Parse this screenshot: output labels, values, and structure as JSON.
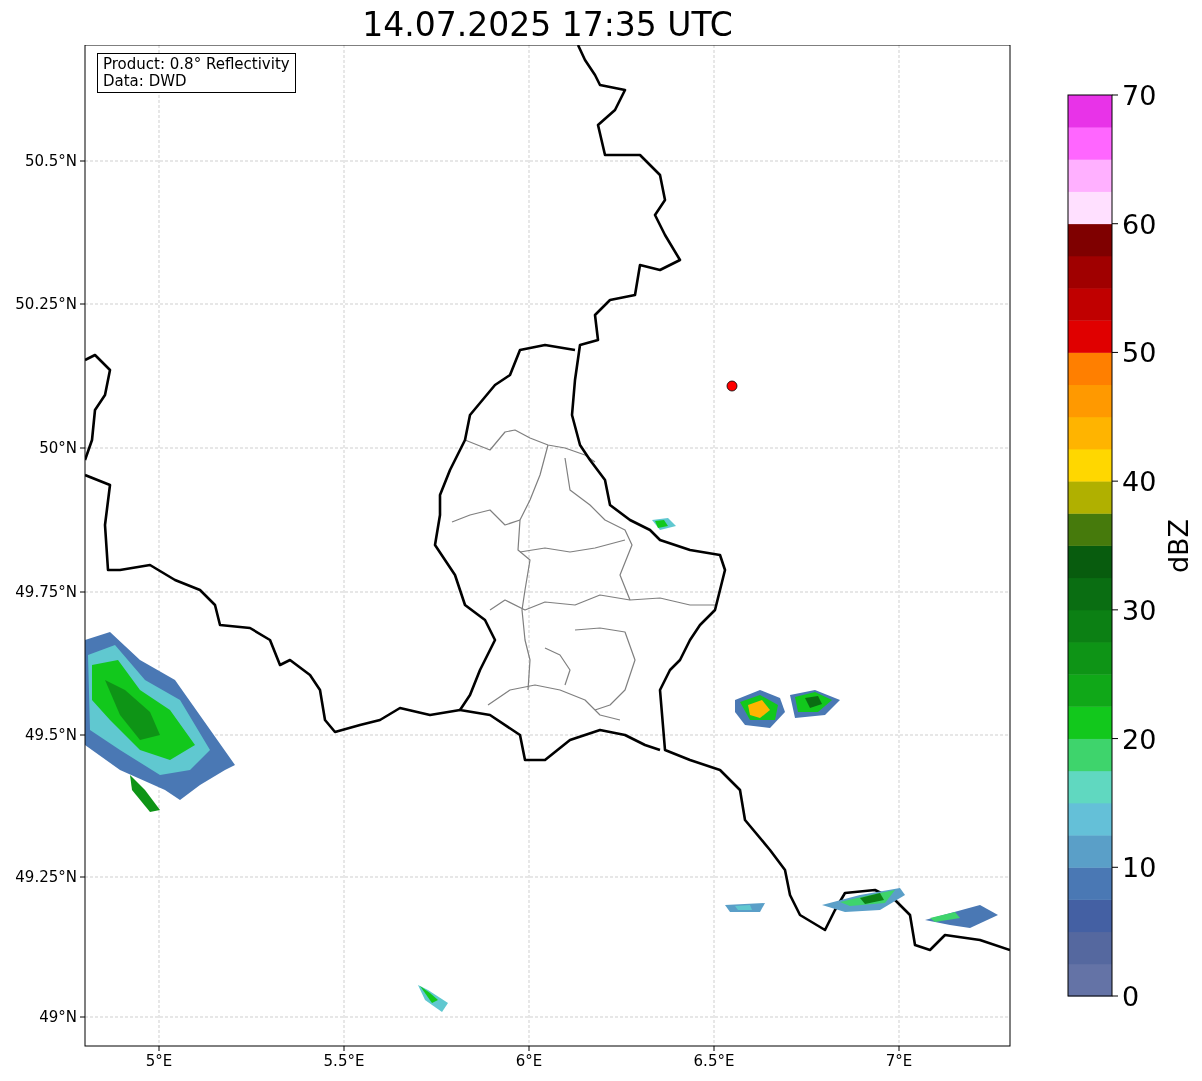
{
  "title": "14.07.2025 17:35 UTC",
  "info_box": {
    "lines": [
      "Product: 0.8° Reflectivity",
      "Data: DWD"
    ]
  },
  "map": {
    "y_ticks": [
      "50.5°N",
      "50.25°N",
      "50°N",
      "49.75°N",
      "49.5°N",
      "49.25°N",
      "49°N"
    ],
    "x_ticks": [
      "5°E",
      "5.5°E",
      "6°E",
      "6.5°E",
      "7°E"
    ]
  },
  "colorbar": {
    "label": "dBZ",
    "ticks": [
      "70",
      "60",
      "50",
      "40",
      "30",
      "20",
      "10",
      "0"
    ],
    "segments": [
      {
        "color": "#6473a6"
      },
      {
        "color": "#55689f"
      },
      {
        "color": "#4460a3"
      },
      {
        "color": "#4a78b4"
      },
      {
        "color": "#5a9fc8"
      },
      {
        "color": "#64c0d8"
      },
      {
        "color": "#60d8c0"
      },
      {
        "color": "#3ed46c"
      },
      {
        "color": "#12c81c"
      },
      {
        "color": "#10a818"
      },
      {
        "color": "#0e9416"
      },
      {
        "color": "#0c8014"
      },
      {
        "color": "#0a6e12"
      },
      {
        "color": "#085c0e"
      },
      {
        "color": "#467a0c"
      },
      {
        "color": "#b0b000"
      },
      {
        "color": "#ffd700"
      },
      {
        "color": "#ffb400"
      },
      {
        "color": "#ff9900"
      },
      {
        "color": "#ff7f00"
      },
      {
        "color": "#e00000"
      },
      {
        "color": "#c00000"
      },
      {
        "color": "#a00000"
      },
      {
        "color": "#7f0000"
      },
      {
        "color": "#ffe0ff"
      },
      {
        "color": "#ffb0ff"
      },
      {
        "color": "#ff66ff"
      },
      {
        "color": "#e833e8"
      }
    ]
  }
}
